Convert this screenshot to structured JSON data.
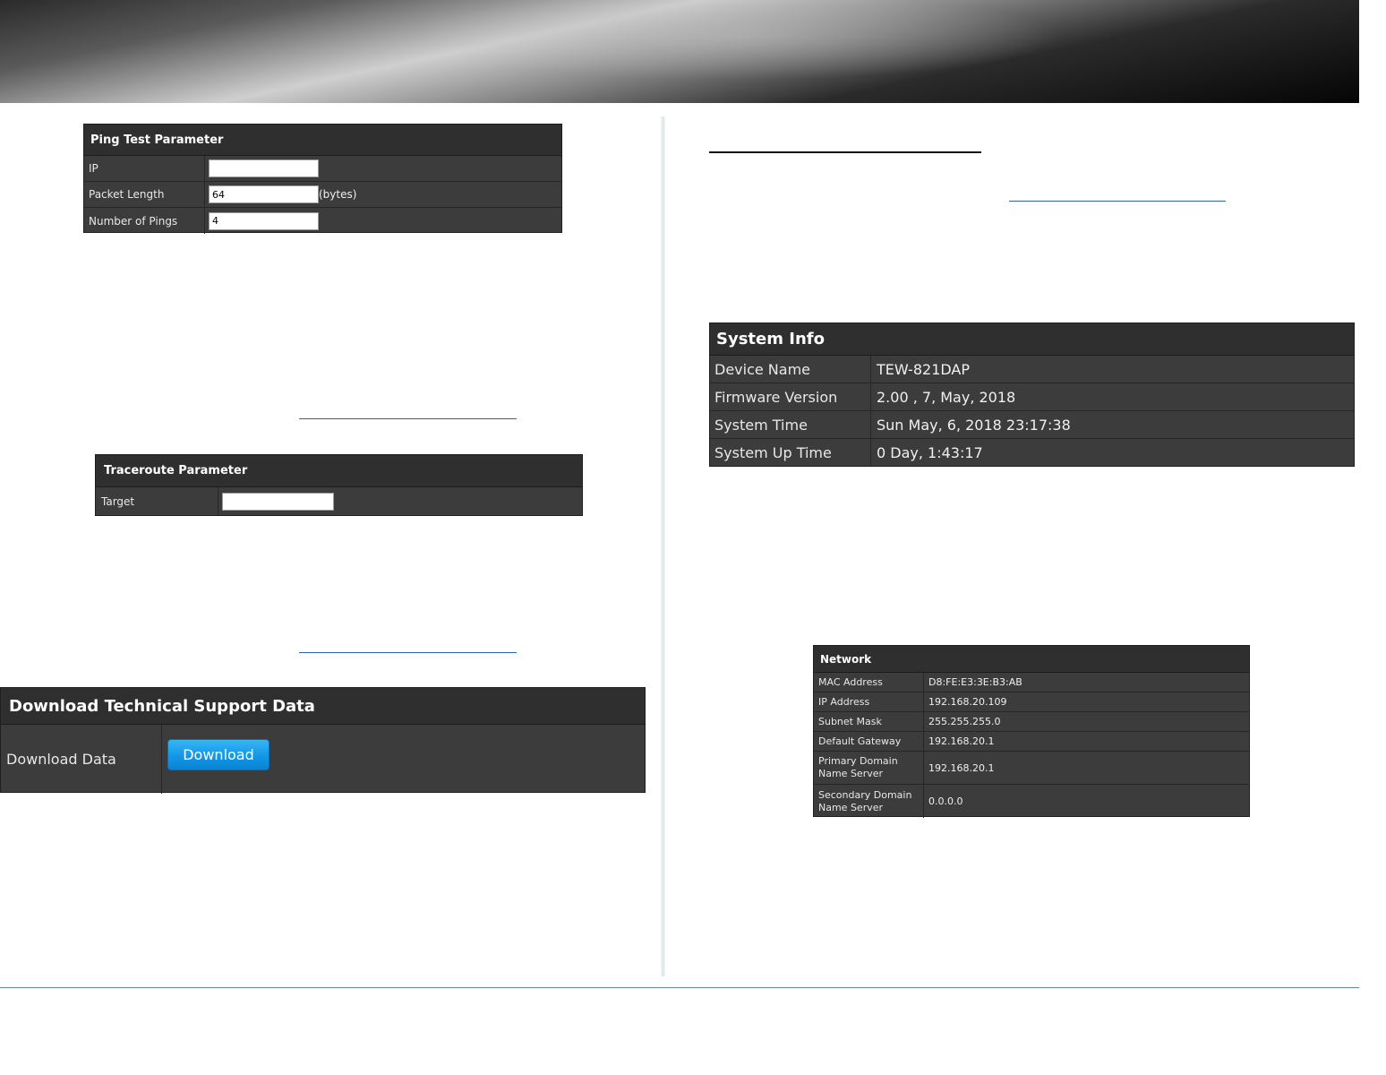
{
  "ping": {
    "title": "Ping Test Parameter",
    "ip_label": "IP",
    "ip_value": "",
    "packet_length_label": "Packet Length",
    "packet_length_value": "64",
    "packet_length_unit": "(bytes)",
    "num_pings_label": "Number of Pings",
    "num_pings_value": "4"
  },
  "traceroute": {
    "title": "Traceroute Parameter",
    "target_label": "Target",
    "target_value": ""
  },
  "support": {
    "title": "Download Technical Support Data",
    "download_data_label": "Download Data",
    "download_button": "Download"
  },
  "system_info": {
    "title": "System Info",
    "rows": [
      {
        "label": "Device Name",
        "value": "TEW-821DAP"
      },
      {
        "label": "Firmware Version",
        "value": "2.00 , 7, May, 2018"
      },
      {
        "label": "System Time",
        "value": "Sun May, 6, 2018 23:17:38"
      },
      {
        "label": "System Up Time",
        "value": "0 Day, 1:43:17"
      }
    ]
  },
  "network": {
    "title": "Network",
    "rows": [
      {
        "label": "MAC Address",
        "value": "D8:FE:E3:3E:B3:AB"
      },
      {
        "label": "IP Address",
        "value": "192.168.20.109"
      },
      {
        "label": "Subnet Mask",
        "value": "255.255.255.0"
      },
      {
        "label": "Default Gateway",
        "value": "192.168.20.1"
      },
      {
        "label": "Primary Domain Name Server",
        "value": "192.168.20.1"
      },
      {
        "label": "Secondary Domain Name Server",
        "value": "0.0.0.0"
      }
    ]
  }
}
